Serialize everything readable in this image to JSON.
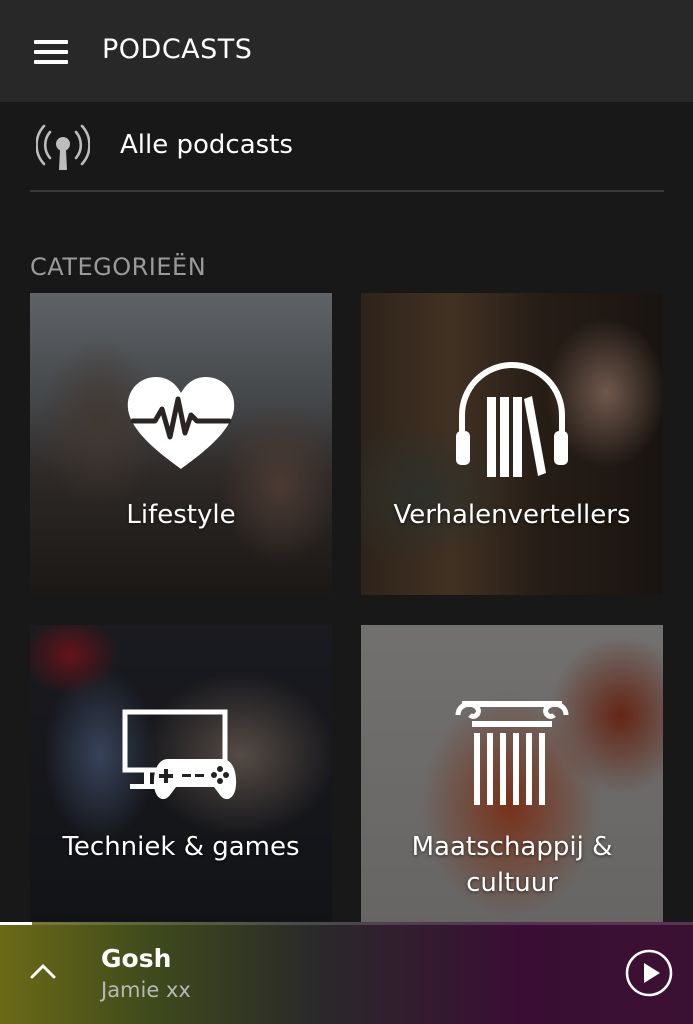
{
  "header": {
    "menu_icon": "hamburger-menu-icon",
    "title": "PODCASTS"
  },
  "all_podcasts": {
    "icon": "podcast-broadcast-icon",
    "label": "Alle podcasts"
  },
  "categories": {
    "section_title": "CATEGORIEËN",
    "items": [
      {
        "label": "Lifestyle",
        "icon": "heartbeat-icon"
      },
      {
        "label": "Verhalenvertellers",
        "icon": "headphones-books-icon"
      },
      {
        "label": "Techniek & games",
        "icon": "monitor-gamepad-icon"
      },
      {
        "label": "Maatschappij &",
        "label_line2": "cultuur",
        "icon": "column-icon"
      }
    ]
  },
  "player": {
    "expand_icon": "chevron-up-icon",
    "title": "Gosh",
    "artist": "Jamie xx",
    "play_icon": "play-circle-icon",
    "progress": 0.046
  },
  "colors": {
    "background": "#181818",
    "topbar": "#282828",
    "section_title": "#9a9a9a"
  }
}
